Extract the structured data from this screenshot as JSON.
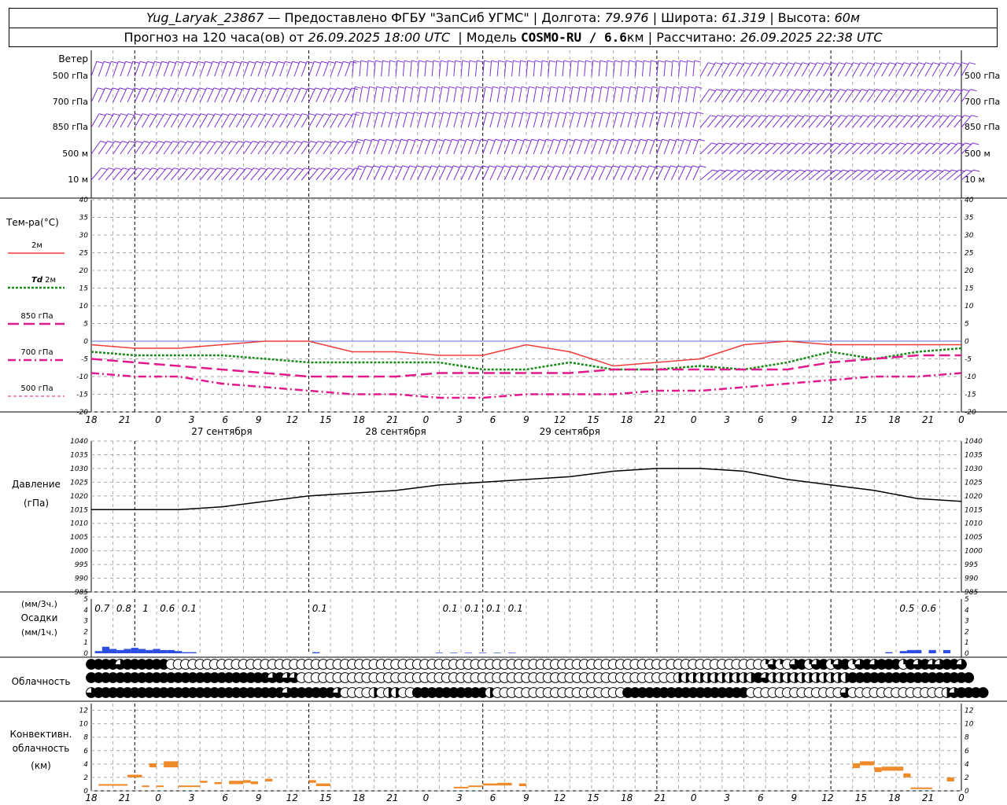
{
  "header": {
    "station": "Yug_Laryak_23867",
    "provider": "— Предоставлено ФГБУ \"ЗапСиб УГМС\"",
    "lon_label": "Долгота:",
    "lon": "79.976",
    "lat_label": "Широта:",
    "lat": "61.319",
    "alt_label": "Высота:",
    "alt": "60м",
    "forecast_prefix": "Прогноз на 120 часа(ов) от",
    "forecast_start": "26.09.2025 18:00 UTC",
    "model_label": "Модель",
    "model": "COSMO-RU / 6.6",
    "model_unit": "км",
    "calc_label": "Рассчитано:",
    "calc_time": "26.09.2025 22:38 UTC"
  },
  "chart_data": [
    {
      "type": "wind-barbs",
      "title": "Ветер",
      "levels": [
        "500 гПа",
        "700 гПа",
        "850 гПа",
        "500 м",
        "10 м"
      ],
      "color": "#7a2fd6"
    },
    {
      "type": "line",
      "ylabel": "Тем-ра(°C)",
      "ylim": [
        -20,
        40
      ],
      "yticks": [
        -20,
        -15,
        -10,
        -5,
        0,
        5,
        10,
        15,
        20,
        25,
        30,
        35,
        40
      ],
      "x_ticks": [
        "18",
        "21",
        "0",
        "3",
        "6",
        "9",
        "12",
        "15",
        "18",
        "21",
        "0",
        "3",
        "6",
        "9",
        "12",
        "15",
        "18",
        "21",
        "0",
        "3",
        "6",
        "9",
        "12",
        "15",
        "18",
        "21",
        "0"
      ],
      "day_labels": [
        "27 сентября",
        "28 сентября",
        "29 сентября"
      ],
      "x_hours": [
        0,
        6,
        12,
        18,
        24,
        30,
        36,
        42,
        48,
        54,
        60,
        66,
        72,
        78,
        84,
        90,
        96,
        102,
        108,
        114,
        120
      ],
      "series": [
        {
          "name": "2м",
          "color": "#f03c3c",
          "values": [
            -1,
            -2,
            -2,
            -1,
            0,
            0,
            -3,
            -3,
            -4,
            -4,
            -1,
            -3,
            -7,
            -6,
            -5,
            -1,
            0,
            -1,
            -1,
            -1,
            -1
          ]
        },
        {
          "name": "Td 2м",
          "name_italic": "Td",
          "name_rest": "2м",
          "color": "#1a8a1a",
          "values": [
            -3,
            -4,
            -4,
            -4,
            -5,
            -6,
            -6,
            -6,
            -6,
            -8,
            -8,
            -6,
            -8,
            -8,
            -7,
            -8,
            -6,
            -3,
            -5,
            -3,
            -2
          ]
        },
        {
          "name": "850 гПа",
          "color": "#e01a8a",
          "values": [
            -5,
            -6,
            -7,
            -8,
            -9,
            -10,
            -10,
            -10,
            -9,
            -9,
            -9,
            -9,
            -8,
            -8,
            -8,
            -8,
            -8,
            -6,
            -5,
            -4,
            -4
          ]
        },
        {
          "name": "700 гПа",
          "color": "#e01a8a",
          "values": [
            -9,
            -10,
            -10,
            -12,
            -13,
            -14,
            -15,
            -15,
            -16,
            -16,
            -15,
            -15,
            -15,
            -14,
            -14,
            -13,
            -12,
            -11,
            -10,
            -10,
            -9
          ]
        },
        {
          "name": "500 гПа",
          "color": "#e01a8a",
          "values": []
        }
      ]
    },
    {
      "type": "line",
      "ylabel": "Давление",
      "yunit": "(гПа)",
      "ylim": [
        985,
        1040
      ],
      "yticks": [
        985,
        990,
        995,
        1000,
        1005,
        1010,
        1015,
        1020,
        1025,
        1030,
        1035,
        1040
      ],
      "x_hours": [
        0,
        6,
        12,
        18,
        24,
        30,
        36,
        42,
        48,
        54,
        60,
        66,
        72,
        78,
        84,
        90,
        96,
        102,
        108,
        114,
        120
      ],
      "series": [
        {
          "name": "Давление",
          "color": "#000000",
          "values": [
            1015,
            1015,
            1015,
            1016,
            1018,
            1020,
            1021,
            1022,
            1024,
            1025,
            1026,
            1027,
            1029,
            1030,
            1030,
            1029,
            1026,
            1024,
            1022,
            1019,
            1018
          ]
        }
      ]
    },
    {
      "type": "bar",
      "ylabel_top": "(мм/3ч.)",
      "ylabel": "Осадки",
      "ylabel_bottom": "(мм/1ч.)",
      "ylim": [
        0,
        5
      ],
      "yticks": [
        0,
        1,
        2,
        3,
        4,
        5
      ],
      "labels": [
        {
          "hour": 1.5,
          "text": "0.7"
        },
        {
          "hour": 4.5,
          "text": "0.8"
        },
        {
          "hour": 7.5,
          "text": "1"
        },
        {
          "hour": 10.5,
          "text": "0.6"
        },
        {
          "hour": 13.5,
          "text": "0.1"
        },
        {
          "hour": 31.5,
          "text": "0.1"
        },
        {
          "hour": 49.5,
          "text": "0.1"
        },
        {
          "hour": 52.5,
          "text": "0.1"
        },
        {
          "hour": 55.5,
          "text": "0.1"
        },
        {
          "hour": 58.5,
          "text": "0.1"
        },
        {
          "hour": 112.5,
          "text": "0.5"
        },
        {
          "hour": 115.5,
          "text": "0.6"
        }
      ],
      "bars": [
        {
          "hour": 1,
          "value": 0.2
        },
        {
          "hour": 2,
          "value": 0.6
        },
        {
          "hour": 3,
          "value": 0.4
        },
        {
          "hour": 4,
          "value": 0.3
        },
        {
          "hour": 5,
          "value": 0.4
        },
        {
          "hour": 6,
          "value": 0.5
        },
        {
          "hour": 7,
          "value": 0.4
        },
        {
          "hour": 8,
          "value": 0.3
        },
        {
          "hour": 9,
          "value": 0.4
        },
        {
          "hour": 10,
          "value": 0.3
        },
        {
          "hour": 11,
          "value": 0.3
        },
        {
          "hour": 12,
          "value": 0.2
        },
        {
          "hour": 13,
          "value": 0.1
        },
        {
          "hour": 14,
          "value": 0.1
        },
        {
          "hour": 31,
          "value": 0.1
        },
        {
          "hour": 48,
          "value": 0.05
        },
        {
          "hour": 50,
          "value": 0.05
        },
        {
          "hour": 52,
          "value": 0.05
        },
        {
          "hour": 54,
          "value": 0.05
        },
        {
          "hour": 56,
          "value": 0.05
        },
        {
          "hour": 58,
          "value": 0.05
        },
        {
          "hour": 110,
          "value": 0.1
        },
        {
          "hour": 112,
          "value": 0.2
        },
        {
          "hour": 113,
          "value": 0.3
        },
        {
          "hour": 114,
          "value": 0.3
        },
        {
          "hour": 116,
          "value": 0.3
        },
        {
          "hour": 118,
          "value": 0.3
        }
      ],
      "color": "#2b4ee0"
    },
    {
      "type": "cloud-cover",
      "ylabel": "Облачность",
      "rows": [
        [
          8,
          8,
          8,
          8,
          6,
          8,
          8,
          8,
          8,
          8,
          8,
          0,
          0,
          0,
          0,
          0,
          0,
          0,
          0,
          0,
          0,
          0,
          0,
          0,
          0,
          0,
          0,
          0,
          0,
          0,
          0,
          0,
          0,
          0,
          0,
          0,
          0,
          0,
          0,
          0,
          0,
          0,
          0,
          0,
          0,
          0,
          0,
          0,
          0,
          0,
          0,
          0,
          0,
          0,
          0,
          0,
          0,
          0,
          0,
          0,
          0,
          0,
          0,
          0,
          0,
          0,
          0,
          0,
          0,
          0,
          0,
          0,
          0,
          0,
          0,
          0,
          0,
          0,
          0,
          0,
          0,
          0,
          0,
          0,
          0,
          0,
          0,
          0,
          0,
          0,
          0,
          0,
          0,
          2,
          6,
          2,
          0,
          6,
          8,
          2,
          6,
          8,
          2,
          6,
          8,
          2,
          6,
          8,
          6,
          8,
          8,
          8,
          2,
          8,
          6,
          8,
          6,
          6,
          8,
          8,
          6
        ],
        [
          8,
          8,
          8,
          8,
          8,
          8,
          8,
          8,
          8,
          8,
          8,
          8,
          8,
          8,
          8,
          8,
          8,
          8,
          8,
          8,
          8,
          8,
          8,
          8,
          8,
          6,
          8,
          6,
          6,
          0,
          0,
          0,
          0,
          0,
          0,
          0,
          0,
          0,
          0,
          0,
          0,
          0,
          0,
          0,
          0,
          0,
          0,
          0,
          0,
          0,
          0,
          0,
          0,
          0,
          0,
          0,
          0,
          0,
          0,
          0,
          0,
          0,
          0,
          0,
          0,
          0,
          0,
          0,
          0,
          0,
          0,
          0,
          0,
          0,
          0,
          0,
          0,
          0,
          0,
          0,
          0,
          4,
          4,
          4,
          4,
          4,
          4,
          4,
          4,
          4,
          4,
          4,
          8,
          6,
          4,
          4,
          4,
          4,
          4,
          4,
          4,
          4,
          4,
          4,
          4,
          8,
          8,
          8,
          8,
          8,
          8,
          8,
          8,
          8,
          8,
          8,
          8,
          8,
          8,
          8,
          8,
          8
        ],
        [
          6,
          8,
          8,
          8,
          8,
          8,
          8,
          8,
          8,
          8,
          8,
          8,
          8,
          8,
          8,
          8,
          8,
          8,
          8,
          8,
          8,
          8,
          8,
          8,
          8,
          8,
          8,
          6,
          8,
          8,
          8,
          8,
          8,
          8,
          6,
          0,
          0,
          0,
          0,
          4,
          0,
          4,
          4,
          0,
          0,
          8,
          8,
          8,
          8,
          8,
          8,
          8,
          8,
          8,
          8,
          4,
          0,
          0,
          0,
          0,
          0,
          0,
          0,
          0,
          0,
          0,
          0,
          0,
          0,
          0,
          0,
          0,
          0,
          0,
          8,
          8,
          8,
          8,
          8,
          8,
          8,
          8,
          8,
          8,
          8,
          8,
          8,
          8,
          8,
          8,
          8,
          0,
          0,
          0,
          0,
          0,
          0,
          0,
          0,
          0,
          0,
          0,
          0,
          0,
          6,
          0,
          0,
          0,
          0,
          0,
          0,
          0,
          0,
          0,
          0,
          0,
          0,
          0,
          4,
          6,
          8,
          8,
          8,
          8
        ]
      ]
    },
    {
      "type": "bar",
      "ylabel": "Конвективн.",
      "ylabel2": "облачность",
      "yunit": "(км)",
      "ylim": [
        0,
        13
      ],
      "yticks": [
        0,
        2,
        4,
        6,
        8,
        10,
        12
      ],
      "color": "#ee8a2a",
      "segments": [
        {
          "hour0": 1,
          "hour1": 5,
          "bottom": 0.8,
          "top": 1.0
        },
        {
          "hour0": 5,
          "hour1": 7,
          "bottom": 2.0,
          "top": 2.4
        },
        {
          "hour0": 7,
          "hour1": 8,
          "bottom": 0.6,
          "top": 0.8
        },
        {
          "hour0": 8,
          "hour1": 9,
          "bottom": 3.5,
          "top": 4.1
        },
        {
          "hour0": 9,
          "hour1": 10,
          "bottom": 0.6,
          "top": 0.8
        },
        {
          "hour0": 10,
          "hour1": 12,
          "bottom": 3.5,
          "top": 4.4
        },
        {
          "hour0": 12,
          "hour1": 15,
          "bottom": 0.6,
          "top": 0.8
        },
        {
          "hour0": 15,
          "hour1": 16,
          "bottom": 1.2,
          "top": 1.5
        },
        {
          "hour0": 17,
          "hour1": 18,
          "bottom": 1.0,
          "top": 1.3
        },
        {
          "hour0": 19,
          "hour1": 21,
          "bottom": 1.0,
          "top": 1.5
        },
        {
          "hour0": 21,
          "hour1": 22,
          "bottom": 1.2,
          "top": 1.6
        },
        {
          "hour0": 22,
          "hour1": 23,
          "bottom": 1.0,
          "top": 1.4
        },
        {
          "hour0": 24,
          "hour1": 25,
          "bottom": 1.4,
          "top": 1.8
        },
        {
          "hour0": 30,
          "hour1": 31,
          "bottom": 1.2,
          "top": 1.6
        },
        {
          "hour0": 31,
          "hour1": 33,
          "bottom": 0.7,
          "top": 1.1
        },
        {
          "hour0": 50,
          "hour1": 52,
          "bottom": 0.4,
          "top": 0.6
        },
        {
          "hour0": 52,
          "hour1": 54,
          "bottom": 0.6,
          "top": 0.8
        },
        {
          "hour0": 54,
          "hour1": 56,
          "bottom": 0.8,
          "top": 1.1
        },
        {
          "hour0": 56,
          "hour1": 58,
          "bottom": 0.8,
          "top": 1.2
        },
        {
          "hour0": 59,
          "hour1": 60,
          "bottom": 0.7,
          "top": 1.1
        },
        {
          "hour0": 105,
          "hour1": 106,
          "bottom": 3.4,
          "top": 4.1
        },
        {
          "hour0": 106,
          "hour1": 108,
          "bottom": 3.8,
          "top": 4.4
        },
        {
          "hour0": 108,
          "hour1": 109,
          "bottom": 2.8,
          "top": 3.5
        },
        {
          "hour0": 109,
          "hour1": 112,
          "bottom": 3.0,
          "top": 3.6
        },
        {
          "hour0": 112,
          "hour1": 113,
          "bottom": 2.0,
          "top": 2.6
        },
        {
          "hour0": 113,
          "hour1": 116,
          "bottom": 0.3,
          "top": 0.5
        },
        {
          "hour0": 118,
          "hour1": 119,
          "bottom": 1.4,
          "top": 2.0
        }
      ]
    }
  ]
}
